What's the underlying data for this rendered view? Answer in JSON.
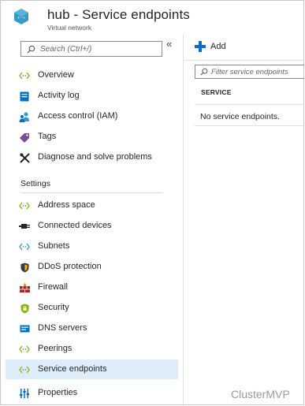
{
  "header": {
    "title": "hub - Service endpoints",
    "subtitle": "Virtual network"
  },
  "left_pane": {
    "search": {
      "placeholder": "Search (Ctrl+/)"
    },
    "collapse_glyph": "«",
    "items_top": [
      {
        "label": "Overview",
        "icon": "vnet-arrows-icon"
      },
      {
        "label": "Activity log",
        "icon": "log-book-icon"
      },
      {
        "label": "Access control (IAM)",
        "icon": "users-icon"
      },
      {
        "label": "Tags",
        "icon": "tag-icon"
      },
      {
        "label": "Diagnose and solve problems",
        "icon": "tools-icon"
      }
    ],
    "section_settings": "Settings",
    "items_settings": [
      {
        "label": "Address space",
        "icon": "vnet-arrows-icon"
      },
      {
        "label": "Connected devices",
        "icon": "plug-icon"
      },
      {
        "label": "Subnets",
        "icon": "vnet-arrows-icon"
      },
      {
        "label": "DDoS protection",
        "icon": "shield-icon"
      },
      {
        "label": "Firewall",
        "icon": "firewall-icon"
      },
      {
        "label": "Security",
        "icon": "security-shield-icon"
      },
      {
        "label": "DNS servers",
        "icon": "dns-server-icon"
      },
      {
        "label": "Peerings",
        "icon": "vnet-arrows-icon"
      },
      {
        "label": "Service endpoints",
        "icon": "vnet-arrows-icon",
        "selected": true
      },
      {
        "label": "Properties",
        "icon": "properties-icon"
      }
    ]
  },
  "right_pane": {
    "add_label": "Add",
    "filter": {
      "placeholder": "Filter service endpoints"
    },
    "table": {
      "columns": [
        "SERVICE"
      ],
      "empty_message": "No service endpoints."
    }
  },
  "watermark": "ClusterMVP",
  "colors": {
    "accent": "#0b6fc7",
    "selected_bg": "#ddeefa",
    "vnet_green": "#7fba00",
    "vnet_blue": "#3999c6"
  }
}
